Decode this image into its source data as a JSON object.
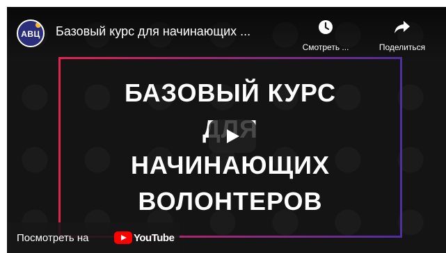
{
  "channel": {
    "avatar_text": "АВЦ"
  },
  "video": {
    "title": "Базовый курс для начинающих ...",
    "headline_lines": [
      "БАЗОВЫЙ КУРС",
      "ДЛЯ",
      "НАЧИНАЮЩИХ",
      "ВОЛОНТЕРОВ"
    ]
  },
  "actions": {
    "watch_later": {
      "label": "Смотреть ...",
      "icon": "clock-icon"
    },
    "share": {
      "label": "Поделиться",
      "icon": "share-arrow-icon"
    }
  },
  "footer": {
    "watch_on_label": "Посмотреть на",
    "brand": "YouTube"
  },
  "colors": {
    "frame_left": "#e02450",
    "frame_right": "#4f2fa0",
    "youtube_red": "#ff0000"
  }
}
